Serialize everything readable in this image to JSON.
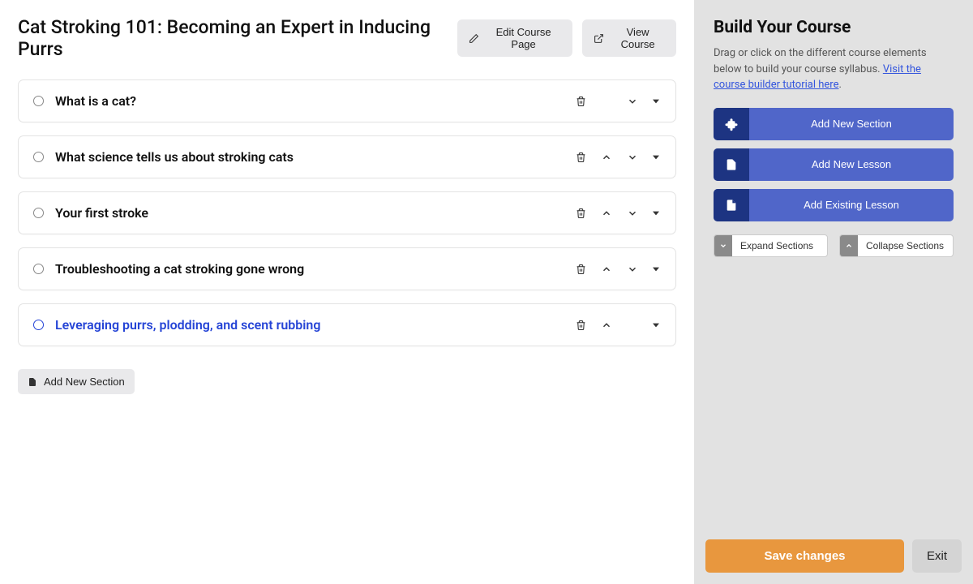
{
  "header": {
    "title": "Cat Stroking 101: Becoming an Expert in Inducing Purrs",
    "edit_label": "Edit Course Page",
    "view_label": "View Course"
  },
  "sections": [
    {
      "title": "What is a cat?",
      "show_up": false,
      "show_down": true,
      "active": false
    },
    {
      "title": "What science tells us about stroking cats",
      "show_up": true,
      "show_down": true,
      "active": false
    },
    {
      "title": "Your first stroke",
      "show_up": true,
      "show_down": true,
      "active": false
    },
    {
      "title": "Troubleshooting a cat stroking gone wrong",
      "show_up": true,
      "show_down": true,
      "active": false
    },
    {
      "title": "Leveraging purrs, plodding, and scent rubbing",
      "show_up": true,
      "show_down": false,
      "active": true
    }
  ],
  "add_section_label": "Add New Section",
  "sidebar": {
    "title": "Build Your Course",
    "description_prefix": "Drag or click on the different course elements below to build your course syllabus. ",
    "tutorial_link_text": "Visit the course builder tutorial here",
    "description_suffix": ".",
    "btn_section": "Add New Section",
    "btn_lesson": "Add New Lesson",
    "btn_existing": "Add Existing Lesson",
    "expand_label": "Expand Sections",
    "collapse_label": "Collapse Sections"
  },
  "footer": {
    "save": "Save changes",
    "exit": "Exit"
  }
}
